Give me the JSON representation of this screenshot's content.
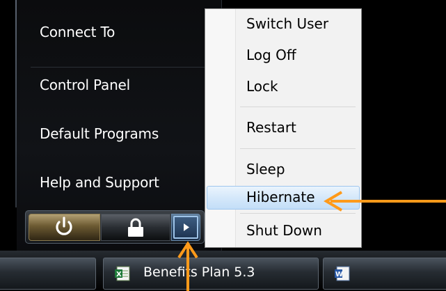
{
  "start_menu": {
    "items": [
      {
        "label": "Connect To"
      },
      {
        "label": "Control Panel"
      },
      {
        "label": "Default Programs"
      },
      {
        "label": "Help and Support"
      }
    ]
  },
  "power_bar": {
    "power_button": "power-icon",
    "lock_button": "lock-icon",
    "more_button": "arrow-right-icon"
  },
  "submenu": {
    "items": [
      {
        "label": "Switch User"
      },
      {
        "label": "Log Off"
      },
      {
        "label": "Lock"
      },
      {
        "label": "Restart"
      },
      {
        "label": "Sleep"
      },
      {
        "label": "Hibernate",
        "highlighted": true
      },
      {
        "label": "Shut Down"
      }
    ]
  },
  "taskbar": {
    "buttons": [
      {
        "label": ""
      },
      {
        "label": "Benefits Plan 5.3",
        "icon": "excel-icon"
      },
      {
        "label": "",
        "icon": "word-icon"
      }
    ]
  },
  "colors": {
    "annotation": "#ff9a1a",
    "highlight": "#c3def8"
  }
}
